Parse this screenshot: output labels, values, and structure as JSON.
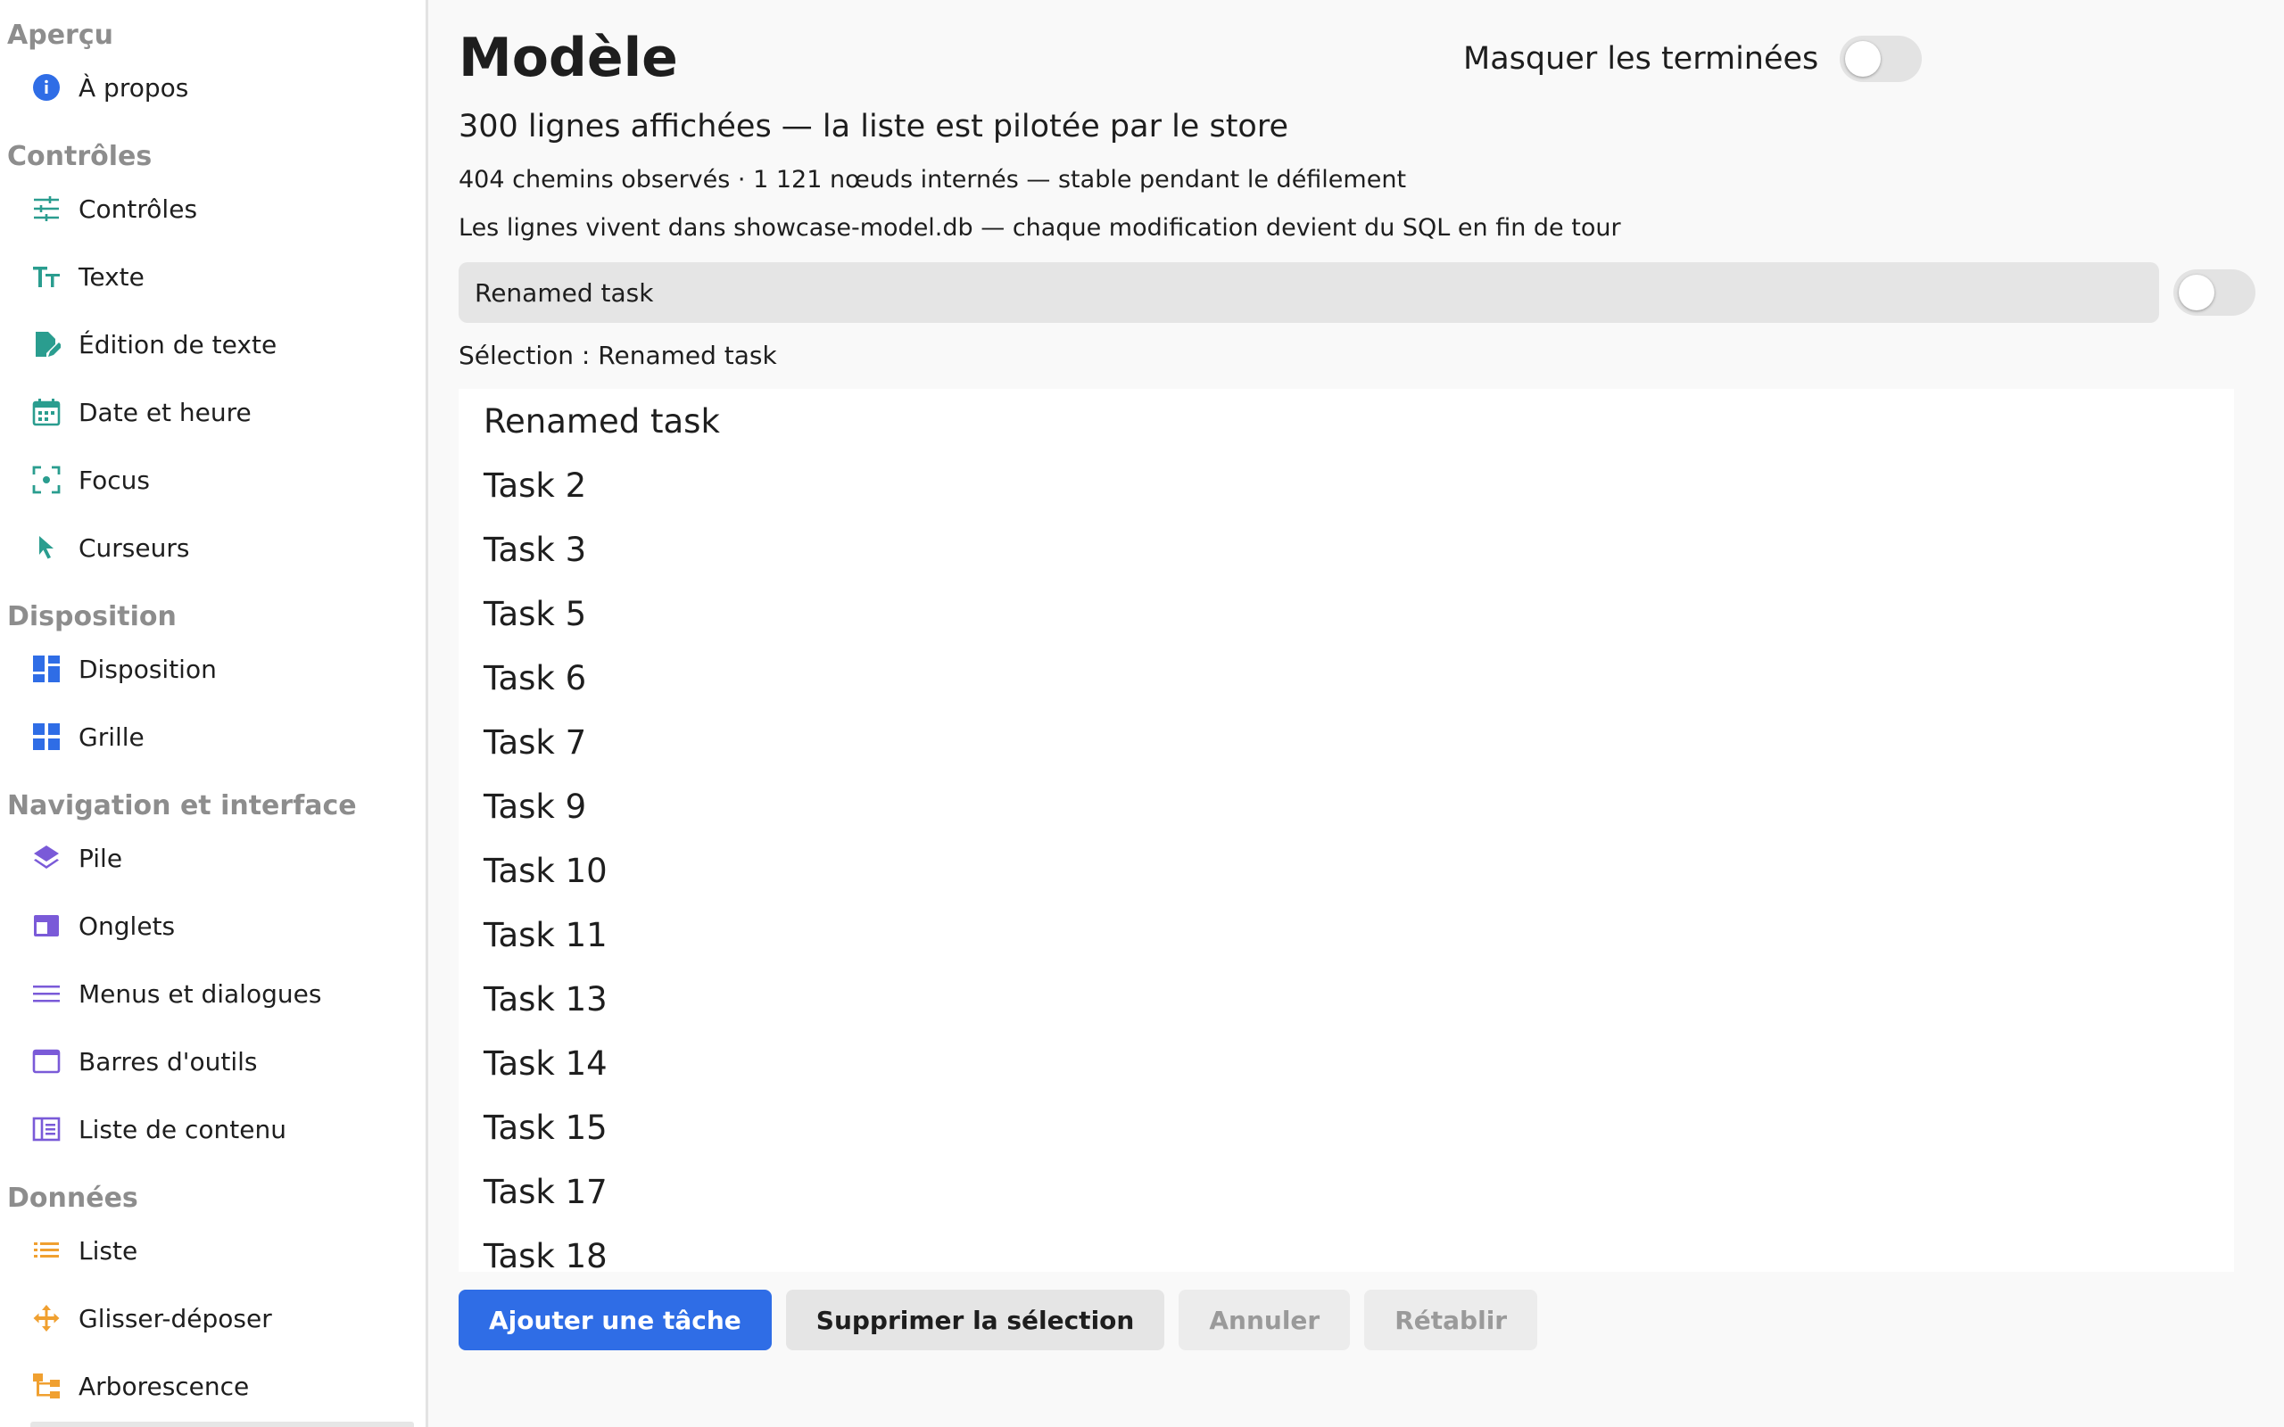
{
  "sidebar": {
    "sections": [
      {
        "title": "Aperçu",
        "items": [
          {
            "label": "À propos",
            "icon": "info-icon"
          }
        ]
      },
      {
        "title": "Contrôles",
        "items": [
          {
            "label": "Contrôles",
            "icon": "sliders-icon"
          },
          {
            "label": "Texte",
            "icon": "text-icon"
          },
          {
            "label": "Édition de texte",
            "icon": "edit-document-icon"
          },
          {
            "label": "Date et heure",
            "icon": "calendar-icon"
          },
          {
            "label": "Focus",
            "icon": "focus-icon"
          },
          {
            "label": "Curseurs",
            "icon": "cursor-icon"
          }
        ]
      },
      {
        "title": "Disposition",
        "items": [
          {
            "label": "Disposition",
            "icon": "layout-icon"
          },
          {
            "label": "Grille",
            "icon": "grid-icon"
          }
        ]
      },
      {
        "title": "Navigation et interface",
        "items": [
          {
            "label": "Pile",
            "icon": "stack-icon"
          },
          {
            "label": "Onglets",
            "icon": "tabs-icon"
          },
          {
            "label": "Menus et dialogues",
            "icon": "menu-icon"
          },
          {
            "label": "Barres d'outils",
            "icon": "toolbar-icon"
          },
          {
            "label": "Liste de contenu",
            "icon": "content-list-icon"
          }
        ]
      },
      {
        "title": "Données",
        "items": [
          {
            "label": "Liste",
            "icon": "list-icon"
          },
          {
            "label": "Glisser-déposer",
            "icon": "drag-drop-icon"
          },
          {
            "label": "Arborescence",
            "icon": "tree-icon"
          }
        ]
      }
    ]
  },
  "main": {
    "title": "Modèle",
    "hide_done_label": "Masquer les terminées",
    "hide_done_enabled": false,
    "subtitle": "300 lignes affichées — la liste est pilotée par le store",
    "stats": "404 chemins observés · 1 121 nœuds internés — stable pendant le défilement",
    "db_note": "Les lignes vivent dans showcase-model.db — chaque modification devient du SQL en fin de tour",
    "rename_value": "Renamed task",
    "done_toggle_enabled": false,
    "selection_label": "Sélection : Renamed task",
    "rows": [
      "Renamed task",
      "Task 2",
      "Task 3",
      "Task 5",
      "Task 6",
      "Task 7",
      "Task 9",
      "Task 10",
      "Task 11",
      "Task 13",
      "Task 14",
      "Task 15",
      "Task 17",
      "Task 18"
    ],
    "actions": {
      "add": "Ajouter une tâche",
      "delete": "Supprimer la sélection",
      "undo": "Annuler",
      "redo": "Rétablir"
    }
  },
  "colors": {
    "accent": "#2f6de6",
    "teal_icon": "#2a9d8f",
    "blue_icon": "#2f6de6",
    "purple_icon": "#7a5ad8",
    "orange_icon": "#f0a030"
  }
}
